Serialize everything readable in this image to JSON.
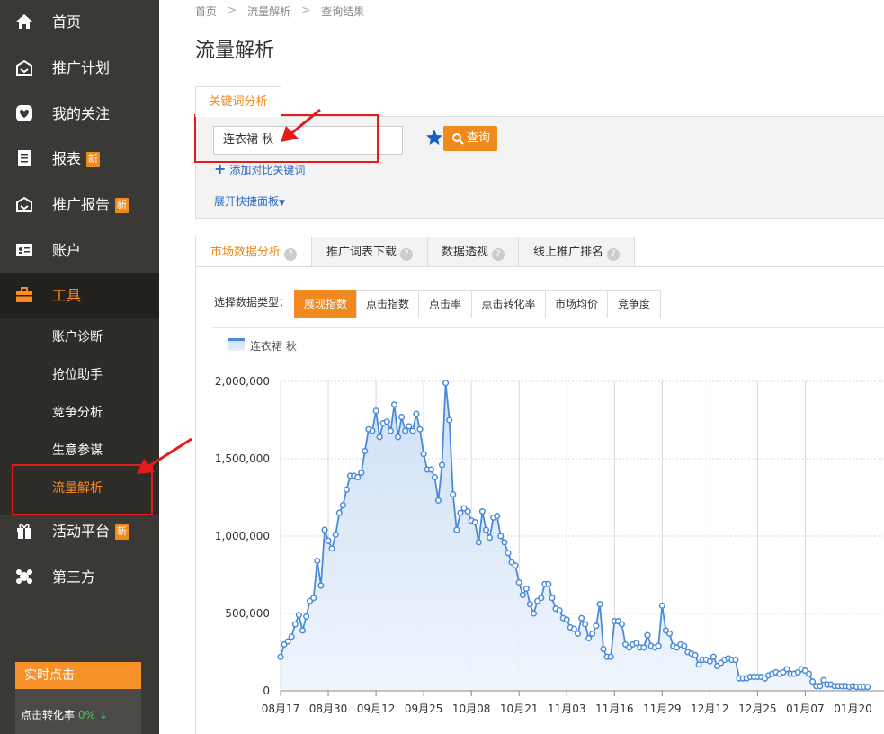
{
  "sidebar": {
    "items": [
      {
        "label": "首页",
        "icon": "home-icon"
      },
      {
        "label": "推广计划",
        "icon": "megaphone-icon"
      },
      {
        "label": "我的关注",
        "icon": "heart-icon"
      },
      {
        "label": "报表",
        "icon": "report-icon",
        "badge": "新"
      },
      {
        "label": "推广报告",
        "icon": "report-box-icon",
        "badge": "新"
      },
      {
        "label": "账户",
        "icon": "id-card-icon"
      },
      {
        "label": "工具",
        "icon": "toolbox-icon"
      },
      {
        "label": "活动平台",
        "icon": "gift-icon",
        "badge": "新"
      },
      {
        "label": "第三方",
        "icon": "apps-icon"
      }
    ],
    "tools_sub": [
      "账户诊断",
      "抢位助手",
      "竞争分析",
      "生意参谋",
      "流量解析"
    ],
    "realtime": {
      "title": "实时点击",
      "label": "点击转化率",
      "value": "0%",
      "trend": "↓"
    }
  },
  "breadcrumb": [
    "首页",
    "流量解析",
    "查询结果"
  ],
  "page_title": "流量解析",
  "keyword_tab": "关键词分析",
  "search": {
    "value": "连衣裙 秋",
    "button": "查询",
    "add_compare": "添加对比关键词",
    "expand_panel": "展开快捷面板"
  },
  "tabs": [
    {
      "label": "市场数据分析",
      "active": true
    },
    {
      "label": "推广词表下载",
      "active": false
    },
    {
      "label": "数据透视",
      "active": false
    },
    {
      "label": "线上推广排名",
      "active": false
    }
  ],
  "data_type": {
    "label": "选择数据类型：",
    "options": [
      "展现指数",
      "点击指数",
      "点击率",
      "点击转化率",
      "市场均价",
      "竞争度"
    ],
    "selected": "展现指数"
  },
  "colors": {
    "accent": "#f0891e",
    "series": "#4a8ad8",
    "alert": "#e21c1c",
    "sidebar": "#3a3935"
  },
  "chart_data": {
    "type": "area",
    "series": [
      {
        "name": "连衣裙 秋"
      }
    ],
    "x_ticks": [
      "08月17",
      "08月30",
      "09月12",
      "09月25",
      "10月08",
      "10月21",
      "11月03",
      "11月16",
      "11月29",
      "12月12",
      "12月25",
      "01月07",
      "01月20"
    ],
    "y_ticks": [
      "0",
      "500,000",
      "1,000,000",
      "1,500,000",
      "2,000,000"
    ],
    "ylim": [
      0,
      2000000
    ],
    "x_start": "08月17",
    "values": [
      220000,
      300000,
      320000,
      350000,
      430000,
      490000,
      390000,
      480000,
      580000,
      600000,
      840000,
      680000,
      1040000,
      970000,
      920000,
      1010000,
      1150000,
      1200000,
      1300000,
      1390000,
      1390000,
      1380000,
      1410000,
      1550000,
      1690000,
      1680000,
      1810000,
      1640000,
      1730000,
      1740000,
      1680000,
      1850000,
      1640000,
      1770000,
      1680000,
      1710000,
      1680000,
      1790000,
      1690000,
      1530000,
      1430000,
      1430000,
      1380000,
      1230000,
      1460000,
      1990000,
      1750000,
      1270000,
      1040000,
      1150000,
      1180000,
      1160000,
      1100000,
      1090000,
      960000,
      1160000,
      1040000,
      990000,
      1120000,
      1130000,
      1000000,
      960000,
      890000,
      830000,
      810000,
      700000,
      620000,
      660000,
      560000,
      500000,
      580000,
      600000,
      690000,
      690000,
      600000,
      530000,
      520000,
      470000,
      460000,
      410000,
      400000,
      370000,
      470000,
      430000,
      340000,
      370000,
      420000,
      560000,
      270000,
      220000,
      220000,
      450000,
      450000,
      430000,
      300000,
      280000,
      300000,
      310000,
      280000,
      280000,
      360000,
      290000,
      280000,
      290000,
      550000,
      390000,
      370000,
      290000,
      280000,
      300000,
      290000,
      250000,
      240000,
      230000,
      170000,
      200000,
      200000,
      190000,
      220000,
      160000,
      180000,
      200000,
      210000,
      200000,
      200000,
      80000,
      80000,
      80000,
      90000,
      90000,
      90000,
      90000,
      80000,
      100000,
      110000,
      120000,
      110000,
      120000,
      140000,
      110000,
      110000,
      120000,
      140000,
      130000,
      110000,
      60000,
      30000,
      30000,
      70000,
      40000,
      40000,
      30000,
      30000,
      30000,
      30000,
      25000,
      30000,
      25000,
      25000,
      25000,
      25000
    ]
  }
}
